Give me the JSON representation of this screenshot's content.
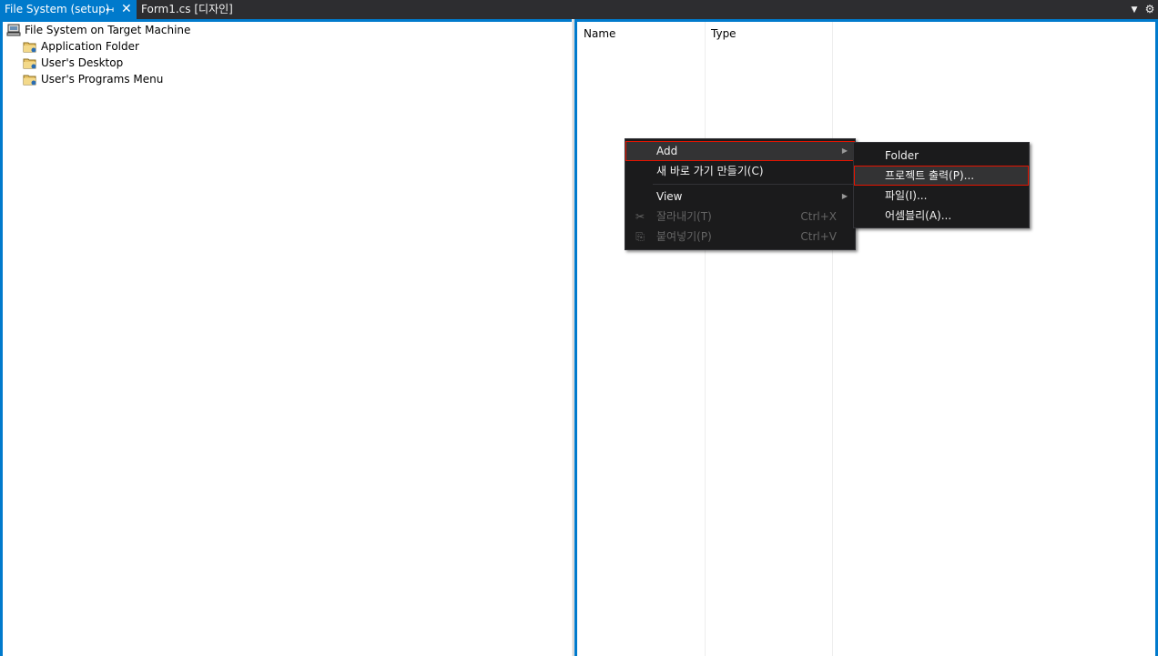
{
  "tabs": {
    "active_label": "File System (setup)",
    "inactive_label": "Form1.cs [디자인]",
    "pin_icon": "pin-icon",
    "close_icon": "close-icon"
  },
  "tree": {
    "root": "File System on Target Machine",
    "items": [
      "Application Folder",
      "User's Desktop",
      "User's Programs Menu"
    ]
  },
  "list": {
    "columns": [
      "Name",
      "Type"
    ]
  },
  "context_menu": {
    "items": [
      {
        "label": "Add",
        "mnemonic": "A",
        "has_submenu": true
      },
      {
        "label": "새 바로 가기 만들기(C)"
      },
      {
        "label": "View",
        "mnemonic": "V",
        "has_submenu": true
      },
      {
        "label": "잘라내기(T)",
        "shortcut": "Ctrl+X",
        "disabled": true,
        "icon": "cut-icon"
      },
      {
        "label": "붙여넣기(P)",
        "shortcut": "Ctrl+V",
        "disabled": true,
        "icon": "paste-icon"
      }
    ]
  },
  "submenu": {
    "items": [
      "Folder",
      "프로젝트 출력(P)...",
      "파일(I)...",
      "어셈블리(A)..."
    ]
  },
  "colors": {
    "accent": "#007acc",
    "menu_bg": "#1b1b1c",
    "highlight_border": "#e51400"
  }
}
